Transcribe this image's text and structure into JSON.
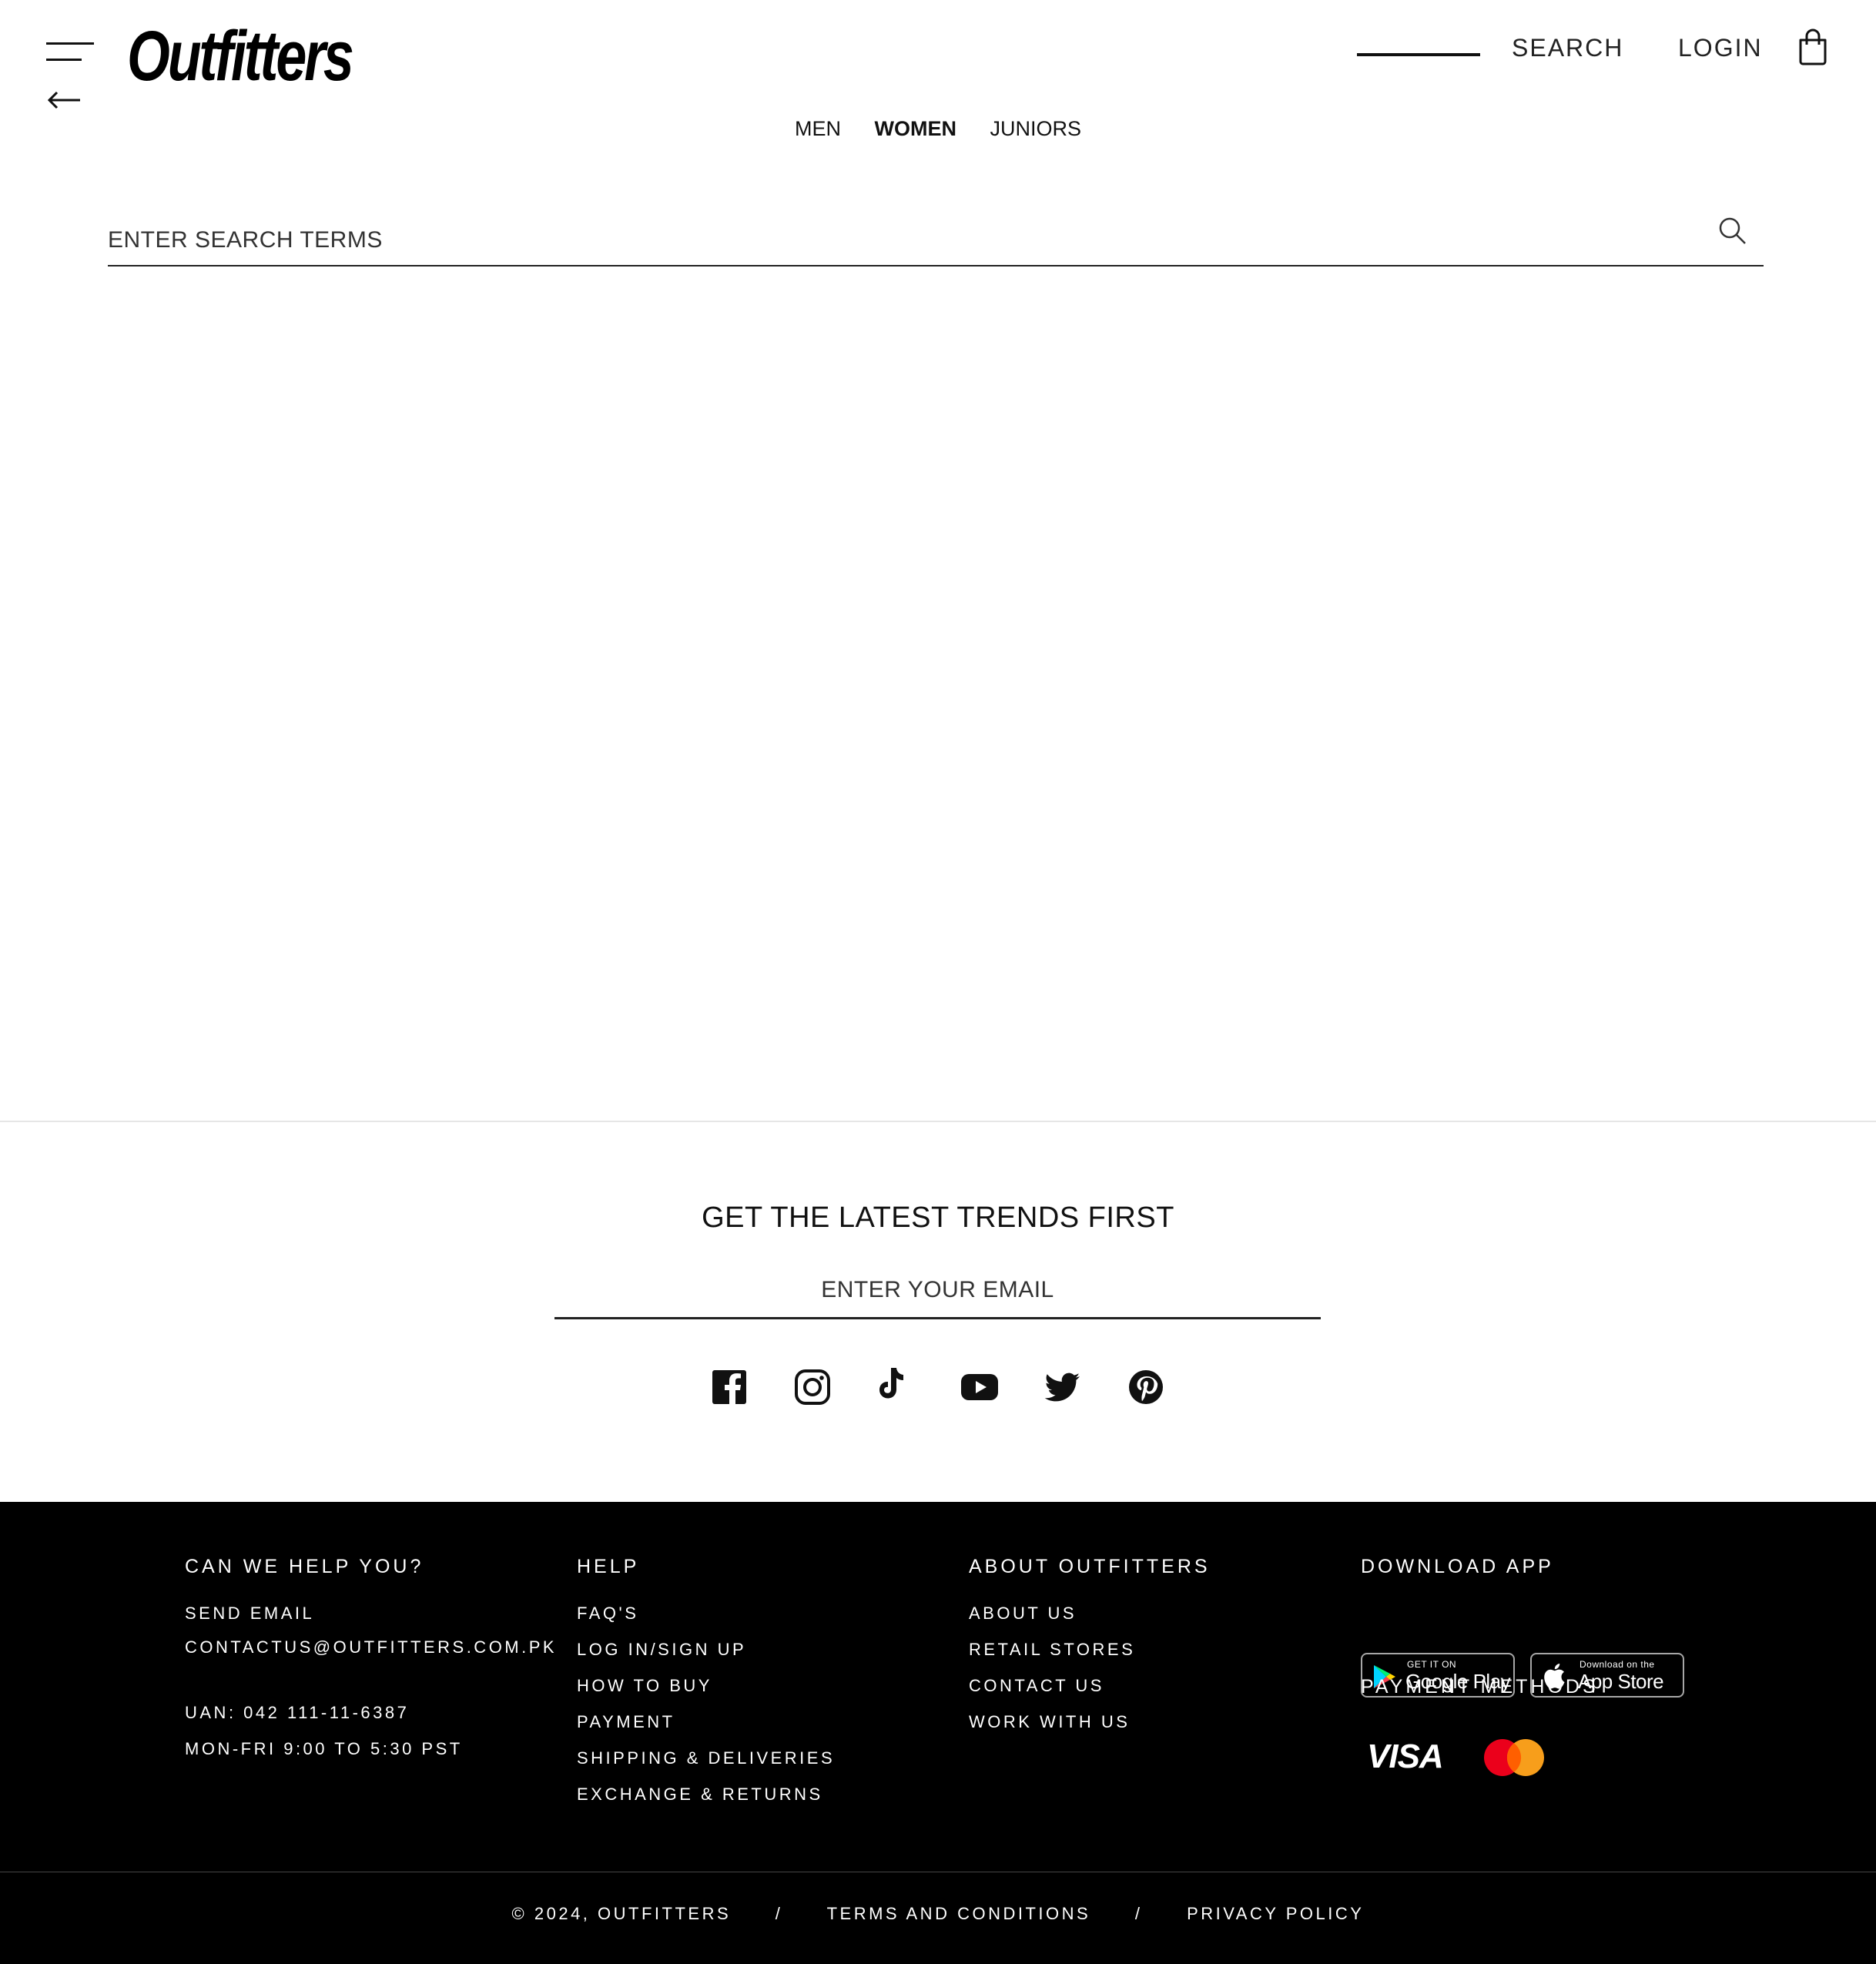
{
  "header": {
    "logo_text": "Outfitters",
    "search_label": "SEARCH",
    "login_label": "LOGIN",
    "icons": [
      "menu-icon",
      "back-arrow-icon",
      "shopping-bag-icon"
    ]
  },
  "category_nav": {
    "items": [
      {
        "label": "MEN",
        "active": false
      },
      {
        "label": "WOMEN",
        "active": true
      },
      {
        "label": "JUNIORS",
        "active": false
      }
    ]
  },
  "search": {
    "placeholder": "ENTER SEARCH TERMS",
    "value": "",
    "icon": "search-icon"
  },
  "newsletter": {
    "title": "GET THE LATEST TRENDS FIRST",
    "email_placeholder": "ENTER YOUR EMAIL",
    "social_icons": [
      "facebook-icon",
      "instagram-icon",
      "tiktok-icon",
      "youtube-icon",
      "twitter-icon",
      "pinterest-icon"
    ]
  },
  "footer": {
    "help_you": {
      "title": "CAN WE HELP YOU?",
      "send_email": "SEND EMAIL",
      "email": "CONTACTUS@OUTFITTERS.COM.PK",
      "uan": "UAN: 042 111-11-6387",
      "hours": "MON-FRI 9:00 TO 5:30 PST"
    },
    "help": {
      "title": "HELP",
      "links": [
        "FAQ'S",
        "LOG IN/SIGN UP",
        "HOW TO BUY",
        "PAYMENT",
        "SHIPPING & DELIVERIES",
        "EXCHANGE & RETURNS"
      ]
    },
    "about": {
      "title": "ABOUT OUTFITTERS",
      "links": [
        "ABOUT US",
        "RETAIL STORES",
        "CONTACT US",
        "WORK WITH US"
      ]
    },
    "app": {
      "title": "DOWNLOAD APP",
      "google_small": "GET IT ON",
      "google_big": "Google Play",
      "apple_small": "Download on the",
      "apple_big": "App Store",
      "payment_title": "PAYMENT METHODS",
      "visa": "VISA"
    },
    "bottom": {
      "copyright": "© 2024, OUTFITTERS",
      "separator": "/",
      "terms": "TERMS AND CONDITIONS",
      "privacy": "PRIVACY POLICY"
    }
  },
  "colors": {
    "background": "#ffffff",
    "text": "#111111",
    "footer_bg": "#000000",
    "mastercard_red": "#eb001b",
    "mastercard_orange": "#f79e1b"
  }
}
